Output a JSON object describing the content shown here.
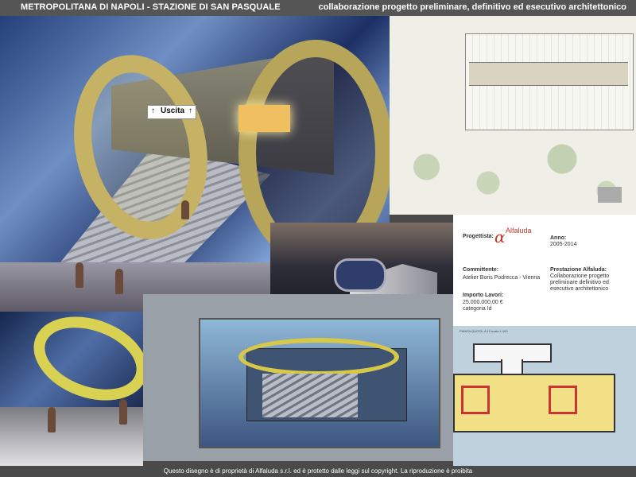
{
  "header": {
    "left_title": "METROPOLITANA DI NAPOLI - STAZIONE DI SAN PASQUALE",
    "right_title": "collaborazione progetto preliminare, definitivo ed esecutivo architettonico"
  },
  "hero": {
    "sign_arrow_left": "↑",
    "sign_text": "Uscita",
    "sign_arrow_right": "↑"
  },
  "info": {
    "progettista_label": "Progettista:",
    "logo_mark": "α",
    "logo_text": "Alfaluda",
    "anno_label": "Anno:",
    "anno_value": "2005-2014",
    "committente_label": "Committente:",
    "committente_value": "Atelier Boris Podrecca - Vienna",
    "prestazione_label": "Prestazione Alfaluda:",
    "prestazione_value": "Collaborazione progetto preliminare definitivo ed esecutivo architettonico",
    "importo_label": "Importo Lavori:",
    "importo_value": "25.000.000,00 €",
    "categoria_value": "categoria Id"
  },
  "floorplan": {
    "title": "PIANTA QUOTA -8.10  scala 1:100"
  },
  "footer": {
    "text": "Questo disegno è di proprietà di Alfaluda s.r.l. ed è protetto dalle leggi sul copyright.  La riproduzione è proibita"
  }
}
